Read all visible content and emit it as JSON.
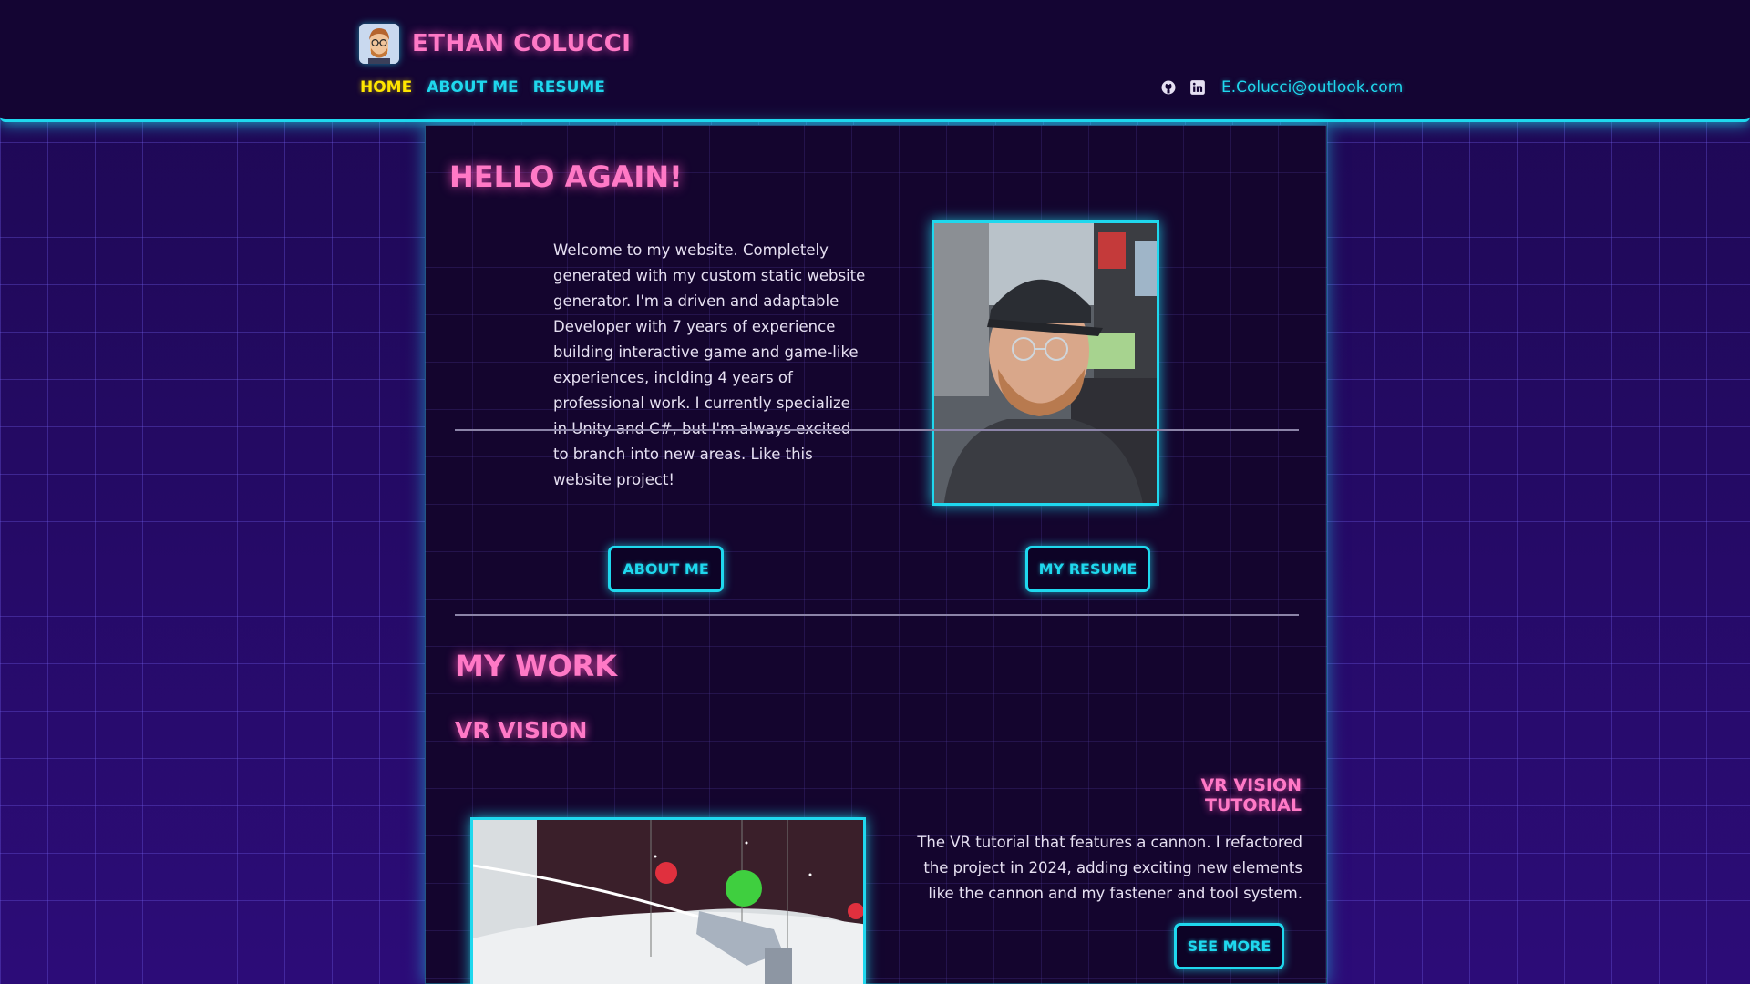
{
  "header": {
    "name": "ETHAN COLUCCI",
    "nav": [
      "HOME",
      "ABOUT ME",
      "RESUME"
    ],
    "active_nav": "HOME",
    "social_icons": [
      "github-icon",
      "linkedin-icon"
    ],
    "email": "E.Colucci@outlook.com"
  },
  "intro": {
    "heading": "HELLO AGAIN!",
    "text": "Welcome to my website. Completely generated with my custom static website generator. I'm a driven and adaptable Developer with 7 years of experience building interactive game and game-like experiences, inclding 4 years of professional work. I currently specialize in Unity and C#, but I'm always excited to branch into new areas. Like this website project!",
    "about_button": "ABOUT ME",
    "resume_button": "MY RESUME"
  },
  "work": {
    "heading": "MY WORK",
    "projects": [
      {
        "title": "VR VISION",
        "subtitle": "VR VISION TUTORIAL",
        "description": "The VR tutorial that features a cannon. I refactored the project in 2024, adding exciting new elements like the cannon and my fastener and tool system.",
        "button": "SEE MORE"
      }
    ]
  },
  "colors": {
    "accent_cyan": "#1fd8ee",
    "accent_pink": "#ff79c6",
    "active_yellow": "#ffe600",
    "background": "#2a0b6e",
    "panel": "#14052e"
  }
}
